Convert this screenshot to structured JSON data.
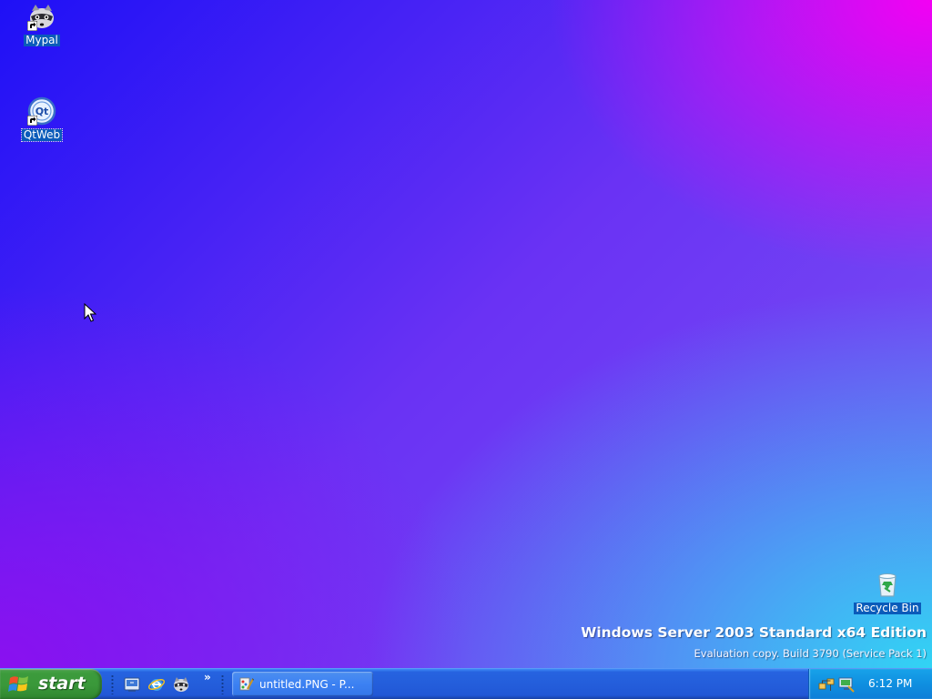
{
  "desktop": {
    "icons": [
      {
        "label": "Mypal",
        "icon": "raccoon-icon"
      },
      {
        "label": "QtWeb",
        "icon": "qt-logo-icon"
      },
      {
        "label": "Recycle Bin",
        "icon": "recycle-bin-icon"
      }
    ],
    "watermark": {
      "title": "Windows Server 2003 Standard x64 Edition",
      "subtitle": "Evaluation copy. Build 3790 (Service Pack 1)"
    }
  },
  "taskbar": {
    "start_label": "start",
    "quick_launch": [
      {
        "icon": "show-desktop-icon"
      },
      {
        "icon": "internet-explorer-icon"
      },
      {
        "icon": "raccoon-icon"
      }
    ],
    "quick_launch_more": "»",
    "tasks": [
      {
        "label": "untitled.PNG - P...",
        "icon": "paint-icon"
      }
    ],
    "tray": {
      "icons": [
        "network-icon",
        "display-icon"
      ],
      "clock": "6:12 PM"
    }
  },
  "colors": {
    "taskbar_blue": "#245edb",
    "start_green": "#3a983a",
    "tray_blue": "#0f8fe0",
    "desktop_top_right": "#f300f3",
    "desktop_bottom_right": "#31d4f4",
    "desktop_left": "#1e10f6"
  }
}
